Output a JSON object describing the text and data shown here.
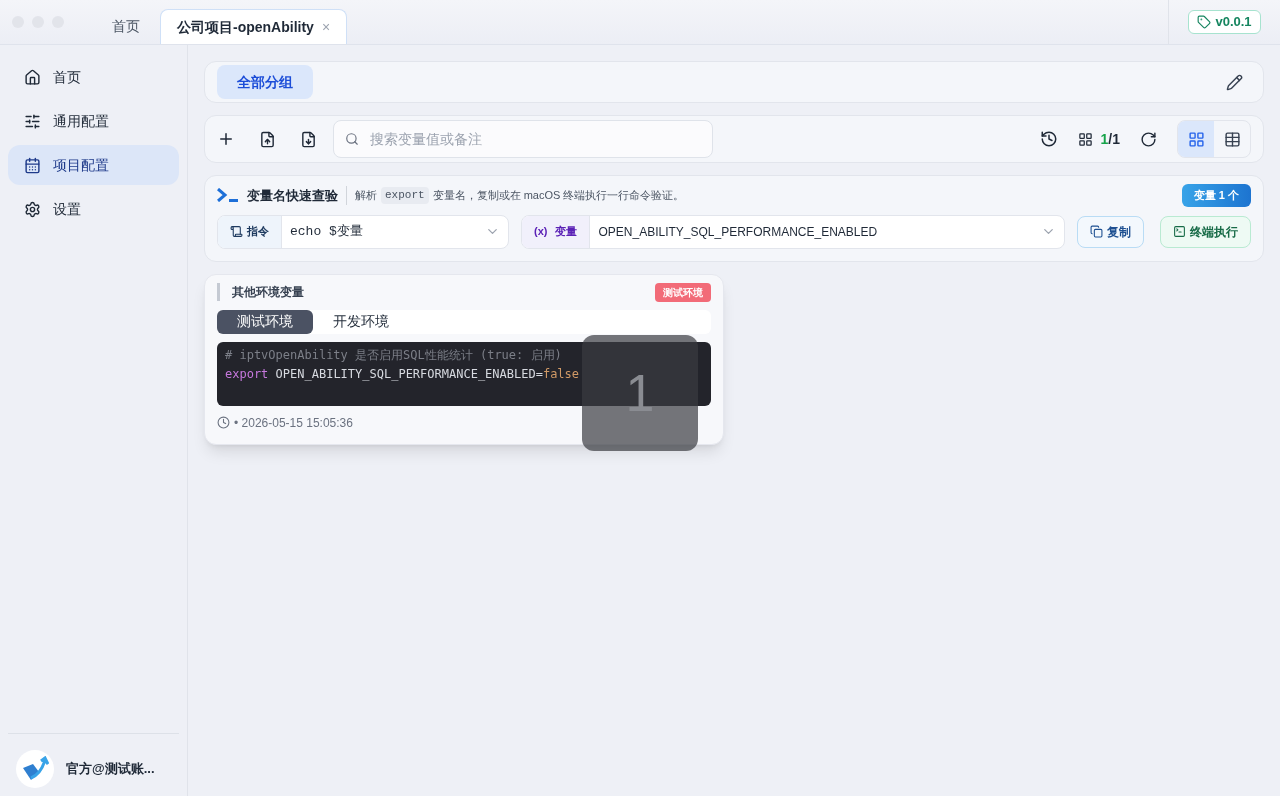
{
  "tabs": [
    {
      "label": "首页",
      "selected": false,
      "closable": false
    },
    {
      "label": "公司项目-openAbility",
      "selected": true,
      "closable": true
    }
  ],
  "close_glyph": "×",
  "version": "v0.0.1",
  "sidebar": {
    "items": [
      {
        "label": "首页",
        "selected": false
      },
      {
        "label": "通用配置",
        "selected": false
      },
      {
        "label": "项目配置",
        "selected": true
      },
      {
        "label": "设置",
        "selected": false
      }
    ],
    "user": "官方@测试账..."
  },
  "groups": [
    {
      "label": "全部分组",
      "selected": true
    }
  ],
  "toolbar": {
    "search_placeholder": "搜索变量值或备注",
    "page_current": "1",
    "page_total": "/1",
    "view": [
      {
        "kind": "grid",
        "selected": true
      },
      {
        "kind": "list",
        "selected": false
      }
    ]
  },
  "quick_check": {
    "title": "变量名快速查验",
    "desc_before": "解析",
    "desc_code": "export",
    "desc_after": "变量名，复制或在 macOS 终端执行一行命令验证。",
    "badge": "变量 1 个",
    "command_label": "指令",
    "command_value": "echo $变量",
    "var_label": "变量",
    "var_symbol": "(x)",
    "var_value": "OPEN_ABILITY_SQL_PERFORMANCE_ENABLED",
    "copy": "复制",
    "run": "终端执行"
  },
  "cards": [
    {
      "group": "其他环境变量",
      "env_badge": "测试环境",
      "env_tabs": [
        {
          "label": "测试环境",
          "selected": true
        },
        {
          "label": "开发环境",
          "selected": false
        }
      ],
      "comment": "# iptvOpenAbility 是否启用SQL性能统计 (true: 启用)",
      "keyword": "export",
      "assignment": "OPEN_ABILITY_SQL_PERFORMANCE_ENABLED=",
      "value": "false",
      "time": "• 2026-05-15 15:05:36"
    }
  ],
  "overlay": {
    "count": "1"
  }
}
